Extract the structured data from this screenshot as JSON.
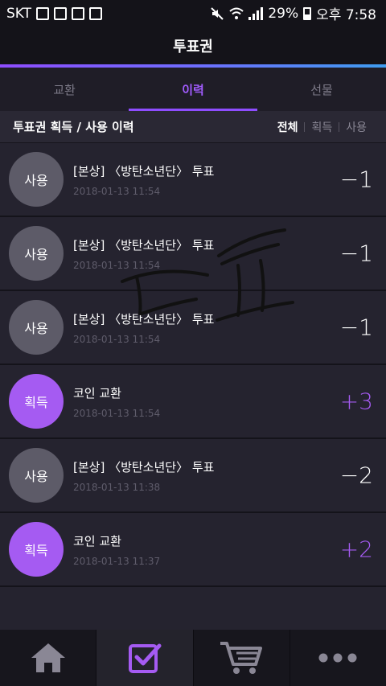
{
  "status_bar": {
    "carrier": "SKT",
    "battery": "29%",
    "time": "오후 7:58"
  },
  "header": {
    "title": "투표권"
  },
  "tabs": [
    {
      "label": "교환",
      "active": false
    },
    {
      "label": "이력",
      "active": true
    },
    {
      "label": "선물",
      "active": false
    }
  ],
  "section": {
    "title": "투표권 획득 / 사용 이력",
    "filters": [
      {
        "label": "전체",
        "active": true
      },
      {
        "label": "획득",
        "active": false
      },
      {
        "label": "사용",
        "active": false
      }
    ]
  },
  "history": [
    {
      "type": "사용",
      "kind": "use",
      "title": "[본상] 〈방탄소년단〉 투표",
      "date": "2018-01-13 11:54",
      "amount": "−1"
    },
    {
      "type": "사용",
      "kind": "use",
      "title": "[본상] 〈방탄소년단〉 투표",
      "date": "2018-01-13 11:54",
      "amount": "−1"
    },
    {
      "type": "사용",
      "kind": "use",
      "title": "[본상] 〈방탄소년단〉 투표",
      "date": "2018-01-13 11:54",
      "amount": "−1"
    },
    {
      "type": "획득",
      "kind": "get",
      "title": "코인 교환",
      "date": "2018-01-13 11:54",
      "amount": "+3"
    },
    {
      "type": "사용",
      "kind": "use",
      "title": "[본상] 〈방탄소년단〉 투표",
      "date": "2018-01-13 11:38",
      "amount": "−2"
    },
    {
      "type": "획득",
      "kind": "get",
      "title": "코인 교환",
      "date": "2018-01-13 11:37",
      "amount": "+2"
    }
  ],
  "bottom_nav": [
    {
      "icon": "home-icon",
      "active": false
    },
    {
      "icon": "vote-check-icon",
      "active": true
    },
    {
      "icon": "cart-icon",
      "active": false
    },
    {
      "icon": "more-icon",
      "active": false
    }
  ],
  "colors": {
    "accent": "#a55bf2",
    "background": "#25232f",
    "use_badge": "#5d5b68"
  }
}
